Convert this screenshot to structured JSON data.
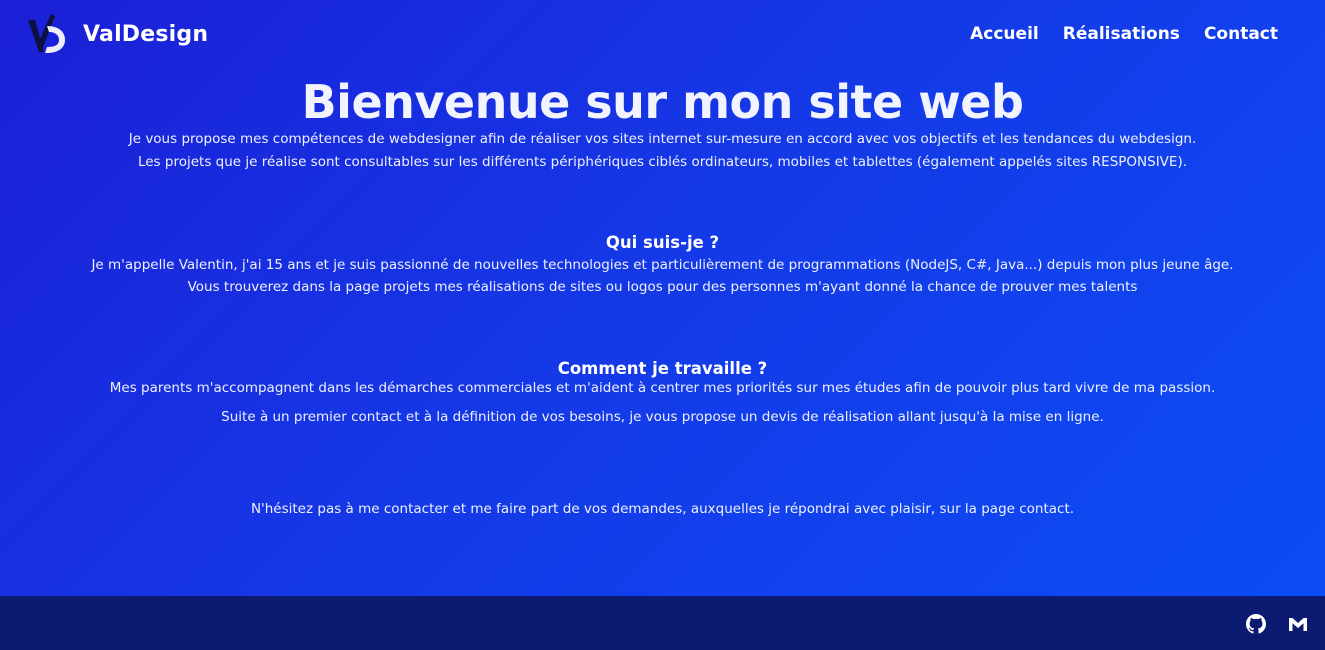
{
  "header": {
    "brand_name": "ValDesign",
    "nav": [
      {
        "label": "Accueil"
      },
      {
        "label": "Réalisations"
      },
      {
        "label": "Contact"
      }
    ]
  },
  "intro": {
    "title": "Bienvenue sur mon site web",
    "lines": [
      "Je vous propose mes compétences de webdesigner afin de réaliser vos sites internet sur-mesure en accord avec vos objectifs et les tendances du webdesign.",
      "Les projets que je réalise sont consultables sur les différents périphériques ciblés ordinateurs, mobiles et tablettes (également appelés sites RESPONSIVE)."
    ]
  },
  "about": {
    "heading": "Qui suis-je ?",
    "lines": [
      "Je m'appelle Valentin, j'ai 15 ans et je suis passionné de nouvelles technologies et particulièrement de programmations (NodeJS, C#, Java...) depuis mon plus jeune âge.",
      "Vous trouverez dans la page projets mes réalisations de sites ou logos pour des personnes m'ayant donné la chance de prouver mes talents"
    ]
  },
  "work": {
    "heading": "Comment je travaille ?",
    "lines": [
      "Mes parents m'accompagnent dans les démarches commerciales et m'aident à centrer mes priorités sur mes études afin de pouvoir plus tard vivre de ma passion.",
      "Suite à un premier contact et à la définition de vos besoins, je vous propose un devis de réalisation allant jusqu'à la mise en ligne."
    ]
  },
  "contact_note": "N'hésitez pas à me contacter et me faire part de vos demandes, auxquelles je répondrai avec plaisir, sur la page contact.",
  "footer": {
    "icons": [
      "github-icon",
      "gmail-icon"
    ]
  },
  "colors": {
    "background_start": "#1b1fd6",
    "background_end": "#0b4ef6",
    "footer": "#0d1a72",
    "text": "#ffffff"
  }
}
